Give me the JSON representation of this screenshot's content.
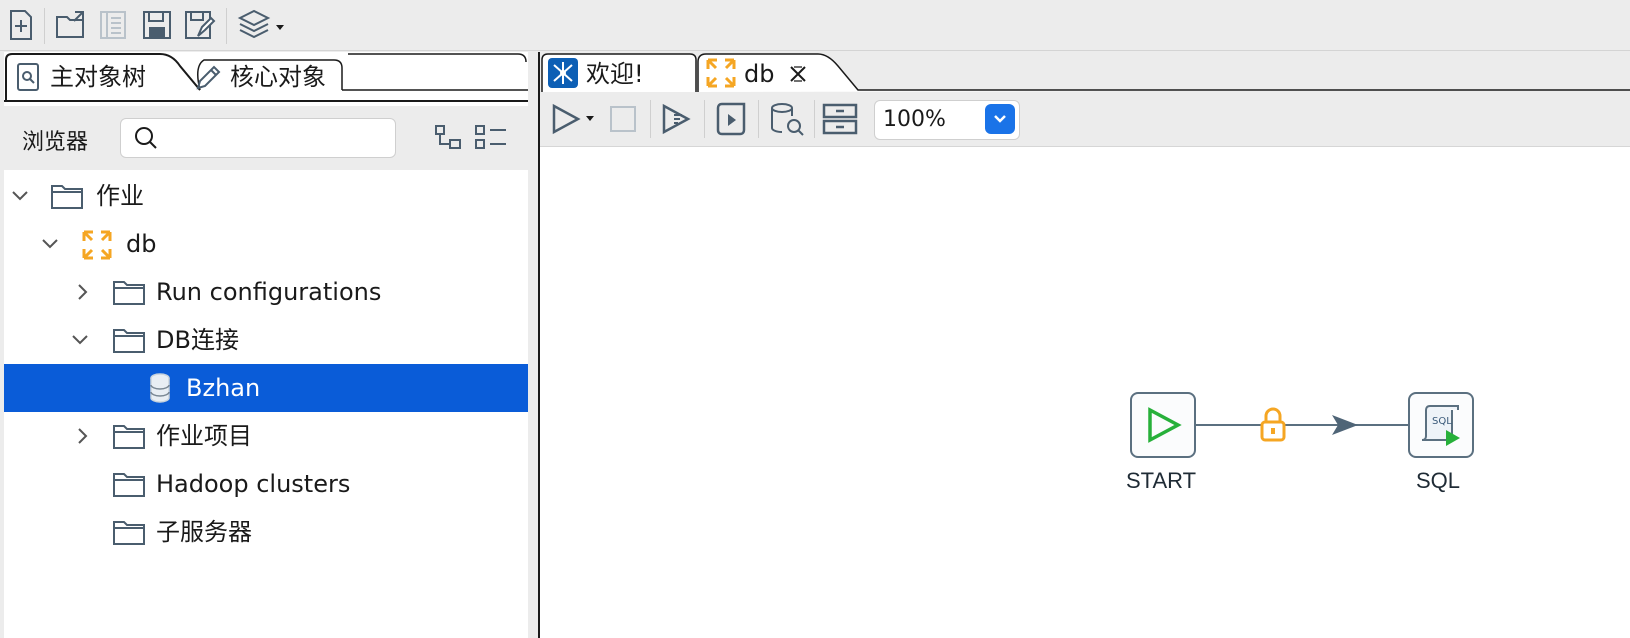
{
  "toolbar": {
    "icons": [
      "new-file-icon",
      "open-folder-icon",
      "explore-repo-icon",
      "save-icon",
      "save-as-icon",
      "layers-icon"
    ]
  },
  "left_panel": {
    "tabs": [
      {
        "label": "主对象树",
        "icon": "main-tree-icon"
      },
      {
        "label": "核心对象",
        "icon": "pencil-icon"
      }
    ],
    "browser_label": "浏览器",
    "search": {
      "value": "",
      "placeholder": ""
    },
    "tree": [
      {
        "label": "作业",
        "expanded": true,
        "icon": "folder-icon"
      },
      {
        "label": "db",
        "expanded": true,
        "icon": "job-icon"
      },
      {
        "label": "Run configurations",
        "expanded": false,
        "icon": "folder-icon"
      },
      {
        "label": "DB连接",
        "expanded": true,
        "icon": "folder-icon"
      },
      {
        "label": "Bzhan",
        "selected": true,
        "icon": "database-icon"
      },
      {
        "label": "作业项目",
        "expanded": false,
        "icon": "folder-icon"
      },
      {
        "label": "Hadoop clusters",
        "icon": "folder-icon"
      },
      {
        "label": "子服务器",
        "icon": "folder-icon"
      }
    ],
    "selection_color": "#0a5cd8"
  },
  "editor": {
    "tabs": [
      {
        "label": "欢迎!",
        "icon": "welcome-icon"
      },
      {
        "label": "db",
        "icon": "job-icon",
        "active": true
      }
    ],
    "zoom": "100%",
    "canvas": {
      "nodes": [
        {
          "label": "START",
          "icon": "start-play-icon"
        },
        {
          "label": "SQL",
          "icon": "sql-script-icon"
        }
      ],
      "hop": {
        "icon": "lock-icon",
        "color": "#f5a623"
      }
    },
    "accent_color": "#1a73e8"
  }
}
